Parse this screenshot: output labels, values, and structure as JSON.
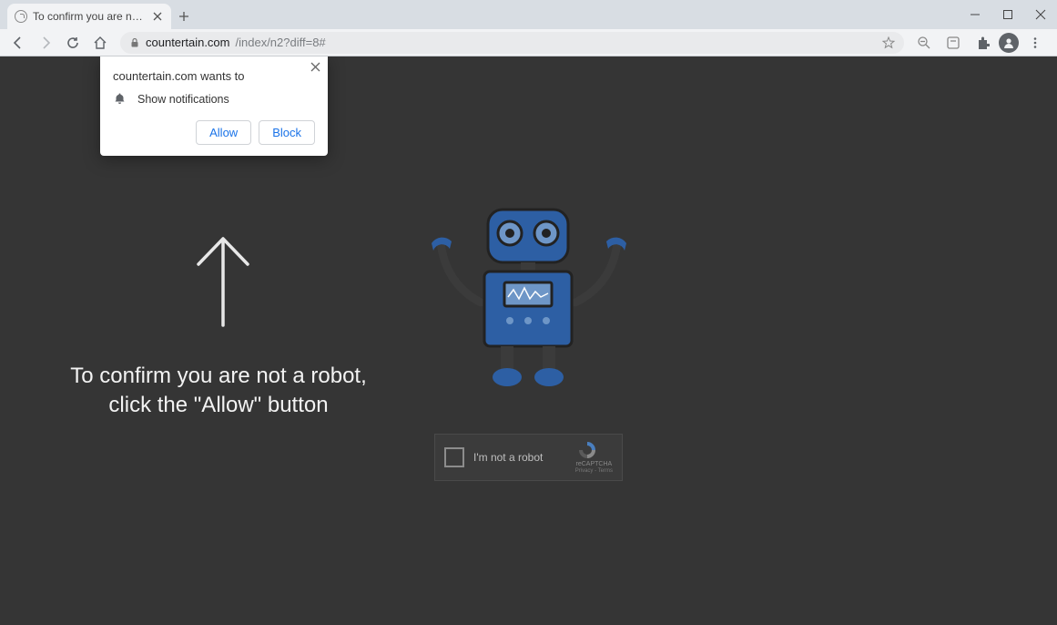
{
  "browser": {
    "tab_title": "To confirm you are not a robot, c",
    "url_domain": "countertain.com",
    "url_path": "/index/n2?diff=8#"
  },
  "notification": {
    "origin_text": "countertain.com wants to",
    "permission_label": "Show notifications",
    "allow_label": "Allow",
    "block_label": "Block"
  },
  "page": {
    "instruction_line1": "To confirm you are not a robot,",
    "instruction_line2": "click the \"Allow\" button"
  },
  "recaptcha": {
    "label": "I'm not a robot",
    "brand": "reCAPTCHA",
    "links": "Privacy - Terms"
  }
}
